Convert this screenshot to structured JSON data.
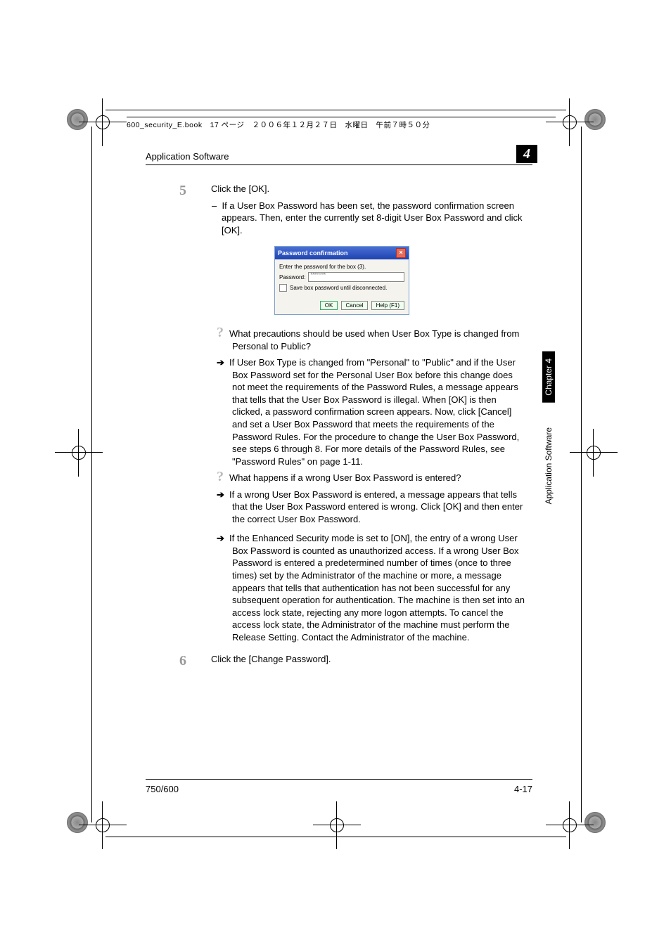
{
  "print_header": "600_security_E.book　17 ページ　２００６年１２月２７日　水曜日　午前７時５０分",
  "section_title": "Application Software",
  "chapter_num_box": "4",
  "steps": {
    "five": {
      "num": "5",
      "text": "Click the [OK].",
      "sub": "If a User Box Password has been set, the password confirmation screen appears. Then, enter the currently set 8-digit User Box Password and click [OK]."
    },
    "six": {
      "num": "6",
      "text": "Click the [Change Password]."
    }
  },
  "dialog": {
    "title": "Password confirmation",
    "prompt": "Enter the password for the box (3).",
    "pwd_label": "Password:",
    "pwd_value": "********",
    "save_label": "Save box password until disconnected.",
    "ok": "OK",
    "cancel": "Cancel",
    "help": "Help (F1)"
  },
  "qa": {
    "q1": "What precautions should be used when User Box Type is changed from Personal to Public?",
    "a1": "If User Box Type is changed from \"Personal\" to \"Public\" and if the User Box Password set for the Personal User Box before this change does not meet the requirements of the Password Rules, a message appears that tells that the User Box Password is illegal. When [OK] is then clicked, a password confirmation screen appears. Now, click [Cancel] and set a User Box Password that meets the requirements of the Password Rules. For the procedure to change the User Box Password, see steps 6 through 8. For more details of the Password Rules, see \"Password Rules\" on page 1-11.",
    "q2": "What happens if a wrong User Box Password is entered?",
    "a2": "If a wrong User Box Password is entered, a message appears that tells that the User Box Password entered is wrong. Click [OK] and then enter the correct User Box Password.",
    "a3": "If the Enhanced Security mode is set to [ON], the entry of a wrong User Box Password is counted as unauthorized access. If a wrong User Box Password is entered a predetermined number of times (once to three times) set by the Administrator of the machine or more, a message appears that tells that authentication has not been successful for any subsequent operation for authentication. The machine is then set into an access lock state, rejecting any more logon attempts. To cancel the access lock state, the Administrator of the machine must perform the Release Setting. Contact the Administrator of the machine."
  },
  "side": {
    "chapter": "Chapter 4",
    "title": "Application Software"
  },
  "footer": {
    "left": "750/600",
    "right": "4-17"
  }
}
